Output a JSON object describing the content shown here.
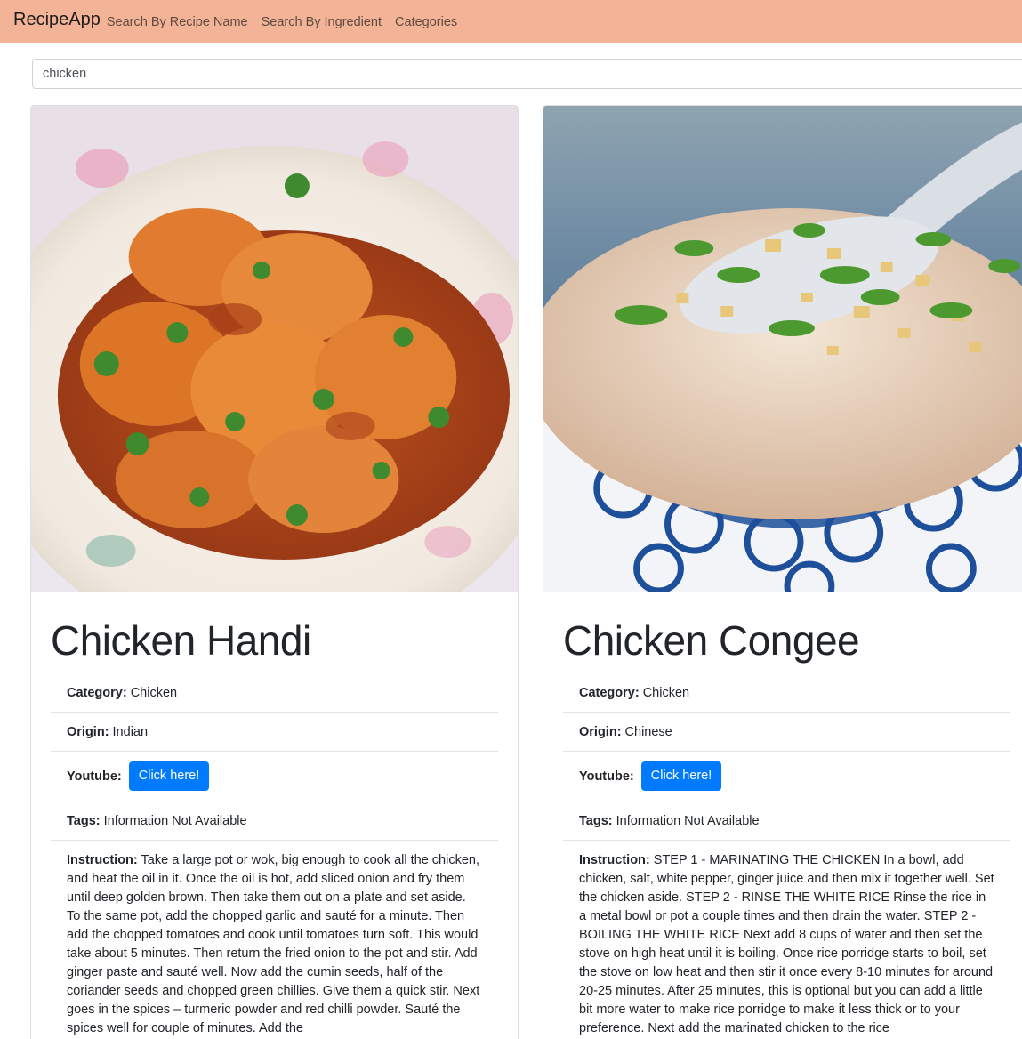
{
  "navbar": {
    "brand": "RecipeApp",
    "links": [
      "Search By Recipe Name",
      "Search By Ingredient",
      "Categories"
    ]
  },
  "search": {
    "value": "chicken"
  },
  "recipes": [
    {
      "title": "Chicken Handi",
      "image_icon": "curry-dish-image",
      "category_label": "Category:",
      "category": "Chicken",
      "origin_label": "Origin:",
      "origin": "Indian",
      "youtube_label": "Youtube:",
      "youtube_button": "Click here!",
      "tags_label": "Tags:",
      "tags": "Information Not Available",
      "instruction_label": "Instruction:",
      "instruction": "Take a large pot or wok, big enough to cook all the chicken, and heat the oil in it. Once the oil is hot, add sliced onion and fry them until deep golden brown. Then take them out on a plate and set aside. To the same pot, add the chopped garlic and sauté for a minute. Then add the chopped tomatoes and cook until tomatoes turn soft. This would take about 5 minutes. Then return the fried onion to the pot and stir. Add ginger paste and sauté well. Now add the cumin seeds, half of the coriander seeds and chopped green chillies. Give them a quick stir. Next goes in the spices – turmeric powder and red chilli powder. Sauté the spices well for couple of minutes. Add the"
    },
    {
      "title": "Chicken Congee",
      "image_icon": "congee-bowl-image",
      "category_label": "Category:",
      "category": "Chicken",
      "origin_label": "Origin:",
      "origin": "Chinese",
      "youtube_label": "Youtube:",
      "youtube_button": "Click here!",
      "tags_label": "Tags:",
      "tags": "Information Not Available",
      "instruction_label": "Instruction:",
      "instruction": "STEP 1 - MARINATING THE CHICKEN In a bowl, add chicken, salt, white pepper, ginger juice and then mix it together well. Set the chicken aside. STEP 2 - RINSE THE WHITE RICE Rinse the rice in a metal bowl or pot a couple times and then drain the water. STEP 2 - BOILING THE WHITE RICE Next add 8 cups of water and then set the stove on high heat until it is boiling. Once rice porridge starts to boil, set the stove on low heat and then stir it once every 8-10 minutes for around 20-25 minutes. After 25 minutes, this is optional but you can add a little bit more water to make rice porridge to make it less thick or to your preference. Next add the marinated chicken to the rice"
    }
  ]
}
